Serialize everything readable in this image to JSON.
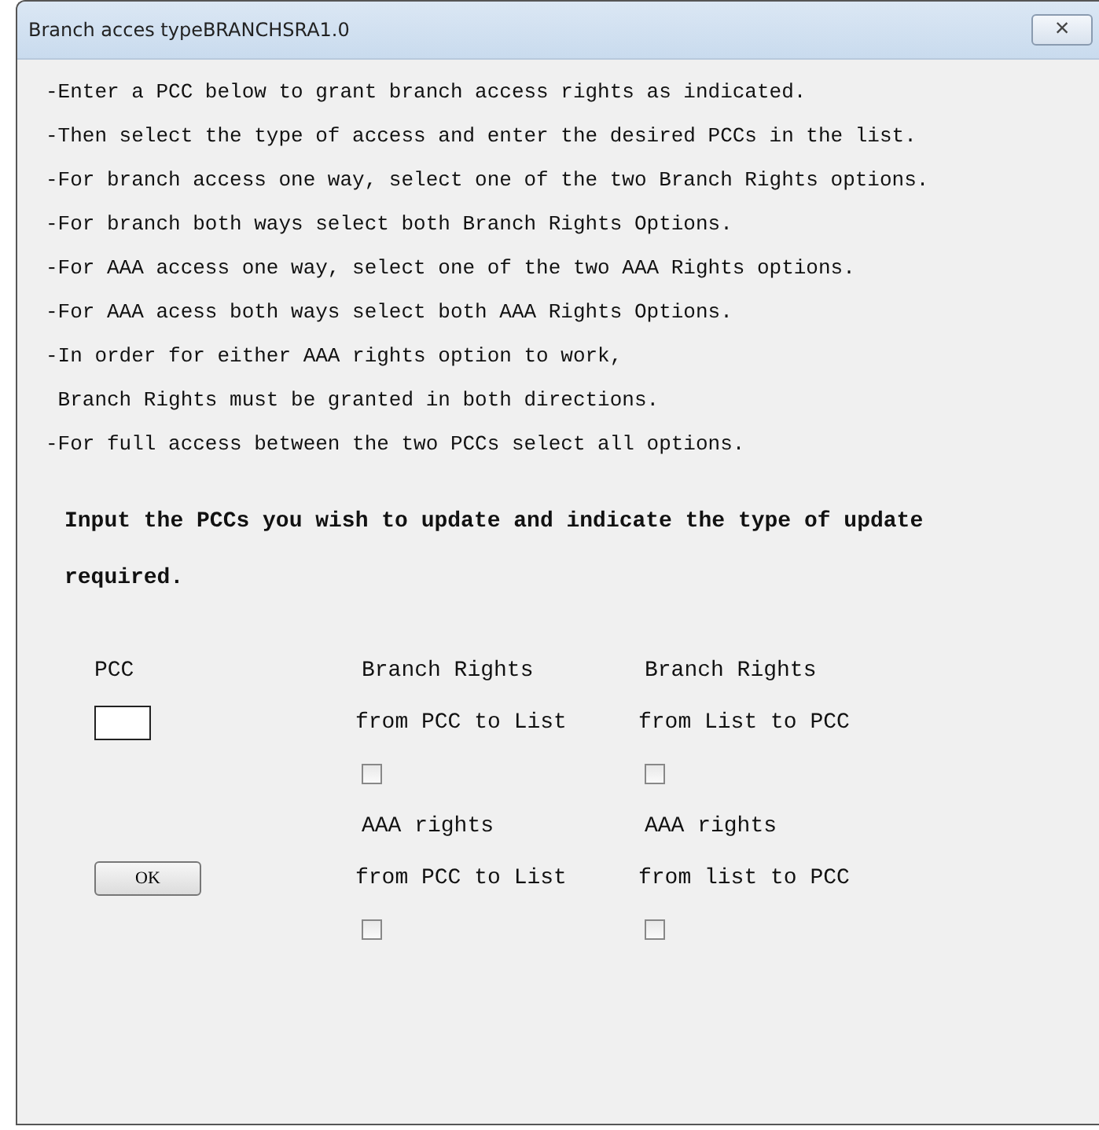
{
  "window": {
    "title": "Branch acces typeBRANCHSRA1.0",
    "close": "×"
  },
  "instructions": [
    "-Enter a PCC below to grant branch access rights as indicated.",
    "-Then select the type of access and enter the desired PCCs in the list.",
    "-For branch access one way, select one of the two Branch Rights options.",
    "-For branch both ways select both Branch Rights Options.",
    "-For AAA access one way, select one of the two AAA Rights options.",
    "-For AAA acess both ways select both AAA Rights Options.",
    "-In order for either AAA rights option to work,",
    " Branch Rights must be granted in both directions.",
    "-For full access between the two PCCs select all options."
  ],
  "prompt": "Input the PCCs you wish to update and indicate the type of update required.",
  "pcc": {
    "label": "PCC"
  },
  "ok_button": "OK",
  "options": [
    {
      "title": "Branch Rights",
      "direction": "from PCC to List",
      "checked": false
    },
    {
      "title": "Branch Rights",
      "direction": "from List to PCC",
      "checked": false
    },
    {
      "title": "AAA rights",
      "direction": "from PCC to List",
      "checked": false
    },
    {
      "title": "AAA rights",
      "direction": "from list to PCC",
      "checked": false
    }
  ]
}
